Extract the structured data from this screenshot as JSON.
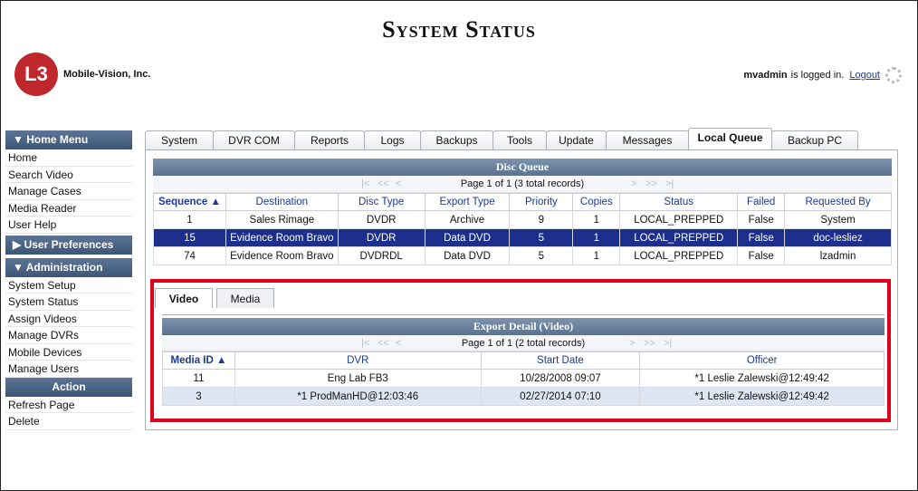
{
  "header": {
    "title": "System Status",
    "company": "Mobile-Vision, Inc.",
    "logo_mark": "L3",
    "user": "mvadmin",
    "logged_text": "is logged in.",
    "logout": "Logout"
  },
  "sidebar": {
    "home_menu": "▼  Home Menu",
    "home_items": [
      "Home",
      "Search Video",
      "Manage Cases",
      "Media Reader",
      "User Help"
    ],
    "user_prefs": "▶  User Preferences",
    "administration": "▼  Administration",
    "admin_items": [
      "System Setup",
      "System Status",
      "Assign Videos",
      "Manage DVRs",
      "Mobile Devices",
      "Manage Users"
    ],
    "action": "Action",
    "action_items": [
      "Refresh Page",
      "Delete"
    ]
  },
  "tabs": [
    "System",
    "DVR COM",
    "Reports",
    "Logs",
    "Backups",
    "Tools",
    "Update",
    "Messages",
    "Local Queue",
    "Backup PC"
  ],
  "active_tab": "Local Queue",
  "disc_queue": {
    "title": "Disc Queue",
    "pager": "Page 1 of 1 (3 total records)",
    "nav": {
      "first": "|<",
      "prev2": "<<",
      "prev": "<",
      "next": ">",
      "next2": ">>",
      "last": ">|"
    },
    "columns": [
      "Sequence ▲",
      "Destination",
      "Disc Type",
      "Export Type",
      "Priority",
      "Copies",
      "Status",
      "Failed",
      "Requested By"
    ],
    "rows": [
      [
        "1",
        "Sales Rimage",
        "DVDR",
        "Archive",
        "9",
        "1",
        "LOCAL_PREPPED",
        "False",
        "System"
      ],
      [
        "15",
        "Evidence Room Bravo",
        "DVDR",
        "Data DVD",
        "5",
        "1",
        "LOCAL_PREPPED",
        "False",
        "doc-lesliez"
      ],
      [
        "74",
        "Evidence Room Bravo",
        "DVDRDL",
        "Data DVD",
        "5",
        "1",
        "LOCAL_PREPPED",
        "False",
        "lzadmin"
      ]
    ]
  },
  "subtabs": [
    "Video",
    "Media"
  ],
  "export_detail": {
    "title": "Export Detail (Video)",
    "pager": "Page 1 of 1 (2 total records)",
    "columns": [
      "Media ID ▲",
      "DVR",
      "Start Date",
      "Officer"
    ],
    "rows": [
      [
        "11",
        "Eng Lab FB3",
        "10/28/2008 09:07",
        "*1 Leslie Zalewski@12:49:42"
      ],
      [
        "3",
        "*1 ProdManHD@12:03:46",
        "02/27/2014 07:10",
        "*1 Leslie Zalewski@12:49:42"
      ]
    ]
  }
}
